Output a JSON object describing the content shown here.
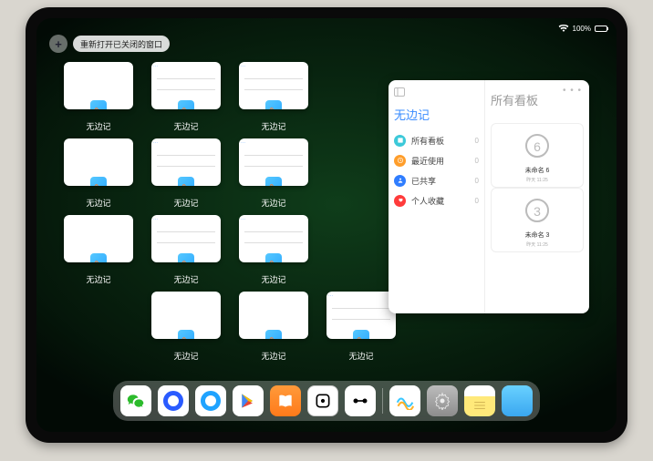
{
  "statusbar": {
    "time": " ",
    "battery": "100%"
  },
  "topbar": {
    "plus": "+",
    "reopen_label": "重新打开已关闭的窗口"
  },
  "app_label": "无边记",
  "windows": [
    {
      "variant": "blank"
    },
    {
      "variant": "tbl"
    },
    {
      "variant": "tbl"
    },
    {
      "variant": "blank"
    },
    {
      "variant": "tbl"
    },
    {
      "variant": "tbl"
    },
    {
      "variant": "blank"
    },
    {
      "variant": "tbl"
    },
    {
      "variant": "tbl"
    },
    {
      "variant": "blank"
    },
    {
      "variant": "blank"
    },
    {
      "variant": "tbl"
    }
  ],
  "split": {
    "left_title": "无边记",
    "right_title": "所有看板",
    "nav": [
      {
        "label": "所有看板",
        "count": "0",
        "color": "#3cc9d9"
      },
      {
        "label": "最近使用",
        "count": "0",
        "color": "#ff9e2b"
      },
      {
        "label": "已共享",
        "count": "0",
        "color": "#2f7dff"
      },
      {
        "label": "个人收藏",
        "count": "0",
        "color": "#ff3b3b"
      }
    ],
    "boards": [
      {
        "label": "未命名 6",
        "time": "昨天 11:25",
        "digit": "6"
      },
      {
        "label": "未命名 3",
        "time": "昨天 11:25",
        "digit": "3"
      }
    ]
  },
  "dock": {
    "items": [
      {
        "name": "wechat-icon"
      },
      {
        "name": "browser-blue-icon"
      },
      {
        "name": "browser-light-icon"
      },
      {
        "name": "play-store-icon"
      },
      {
        "name": "books-icon"
      },
      {
        "name": "dice-icon"
      },
      {
        "name": "barbell-icon"
      }
    ],
    "recents": [
      {
        "name": "freeform-icon"
      },
      {
        "name": "settings-icon"
      },
      {
        "name": "notes-icon"
      },
      {
        "name": "app-library-icon"
      }
    ]
  }
}
